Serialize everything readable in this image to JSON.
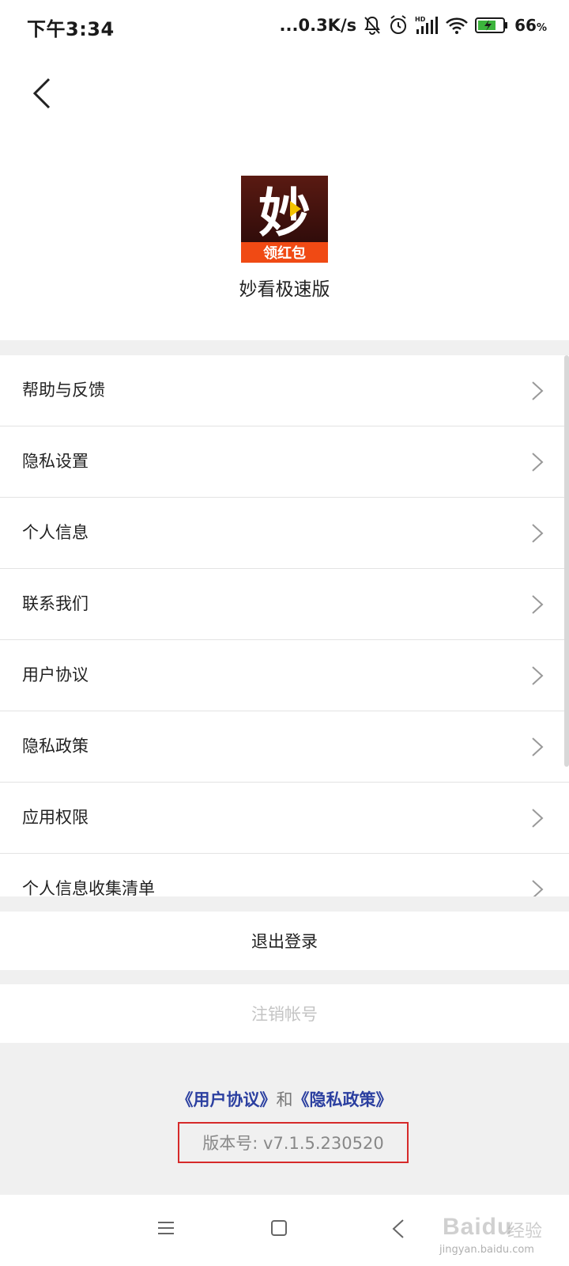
{
  "status_bar": {
    "time": "下午3:34",
    "network_speed": "...0.3K/s",
    "battery_percent": "66",
    "battery_unit": "%",
    "icons": [
      "bell-muted-icon",
      "alarm-icon",
      "hd-signal-icon",
      "wifi-icon",
      "battery-charging-icon"
    ]
  },
  "header": {
    "back_icon": "chevron-left-icon",
    "app_name": "妙看极速版",
    "logo": {
      "glyph": "妙",
      "banner_text": "领红包",
      "colors": {
        "background": "#3a1010",
        "banner": "#f04a14",
        "play": "#f5c400"
      }
    }
  },
  "menu": {
    "items": [
      {
        "label": "帮助与反馈"
      },
      {
        "label": "隐私设置"
      },
      {
        "label": "个人信息"
      },
      {
        "label": "联系我们"
      },
      {
        "label": "用户协议"
      },
      {
        "label": "隐私政策"
      },
      {
        "label": "应用权限"
      },
      {
        "label": "个人信息收集清单"
      }
    ]
  },
  "actions": {
    "logout_label": "退出登录",
    "cancel_account_label": "注销帐号"
  },
  "footer": {
    "user_agreement_link": "《用户协议》",
    "connector": "和",
    "privacy_policy_link": "《隐私政策》",
    "version": "版本号: v7.1.5.230520",
    "highlight_color": "#d62a2a",
    "link_color": "#2b3fa0"
  },
  "nav_bar": {
    "icons": [
      "menu-icon",
      "home-square-icon",
      "back-triangle-icon"
    ]
  },
  "watermark": {
    "brand": "Baidu",
    "cn": "经验",
    "url": "jingyan.baidu.com"
  }
}
